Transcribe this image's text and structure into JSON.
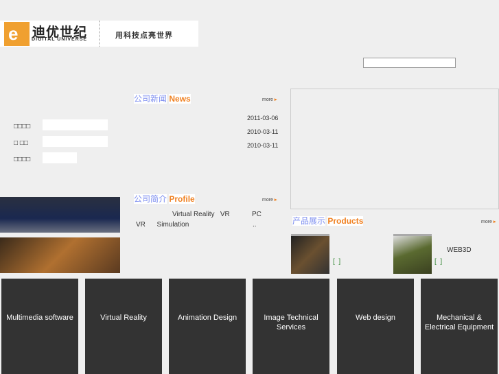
{
  "header": {
    "logo_cn": "迪优世纪",
    "logo_en": "DIGITAL UNIVERSE",
    "slogan": "用科技点亮世界",
    "search_value": ""
  },
  "news": {
    "title_cn": "公司新闻",
    "title_en": "News",
    "more": "more",
    "dates": [
      "2011-03-06",
      "2010-03-11",
      "2010-03-11"
    ]
  },
  "login": {
    "labels": [
      "□□□□",
      "□ □□",
      "□□□□"
    ]
  },
  "profile": {
    "title_cn": "公司简介",
    "title_en": "Profile",
    "more": "more",
    "line1": "Virtual Reality   VR",
    "line1b": "PC",
    "line2": "VR      Simulation",
    "line2b": ".."
  },
  "products": {
    "title_cn": "产品展示",
    "title_en": "Products",
    "more": "more",
    "items": [
      {
        "bracket": "[  ]",
        "caption": ""
      },
      {
        "bracket": "[  ]",
        "caption": "WEB3D"
      }
    ]
  },
  "services": [
    "Multimedia software",
    "Virtual Reality",
    "Animation Design",
    "Image Technical Services",
    "Web design",
    "Mechanical & Electrical Equipment",
    ""
  ]
}
